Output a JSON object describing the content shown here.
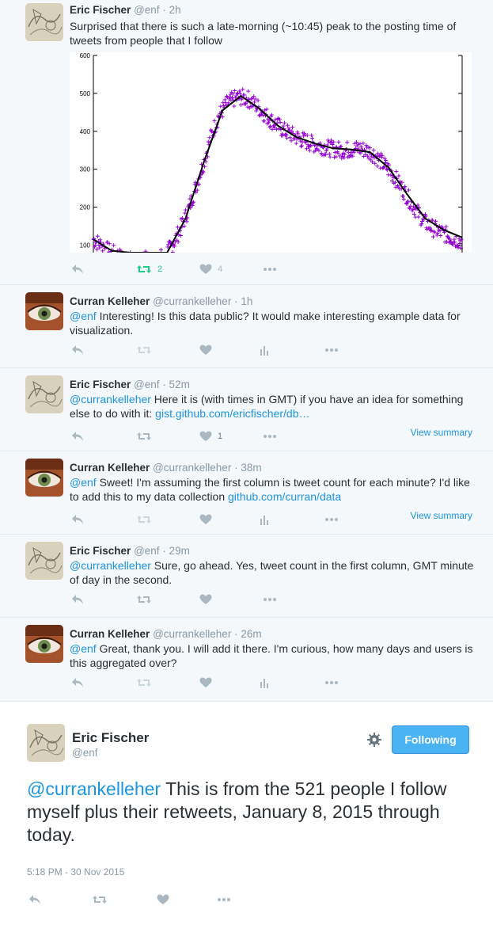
{
  "tweets": [
    {
      "name": "Eric Fischer",
      "handle": "@enf",
      "time": "· 2h",
      "avatar": "map",
      "text": "Surprised that there is such a late-morning (~10:45) peak to the posting time of tweets from people that I follow",
      "retweets": "2",
      "likes": "4",
      "retweet_active": true
    },
    {
      "name": "Curran Kelleher",
      "handle": "@currankelleher",
      "time": "· 1h",
      "avatar": "eye",
      "mention": "@enf",
      "text": " Interesting! Is this data public? It would make interesting example data for visualization."
    },
    {
      "name": "Eric Fischer",
      "handle": "@enf",
      "time": "· 52m",
      "avatar": "map",
      "mention": "@currankelleher",
      "text": " Here it is (with times in GMT) if you have an idea for something else to do with it: ",
      "link": "gist.github.com/ericfischer/db…",
      "likes": "1",
      "summary": "View summary"
    },
    {
      "name": "Curran Kelleher",
      "handle": "@currankelleher",
      "time": "· 38m",
      "avatar": "eye",
      "mention": "@enf",
      "text": " Sweet! I'm assuming the first column is tweet count for each minute? I'd like to add this to my data collection ",
      "link": "github.com/curran/data",
      "summary": "View summary"
    },
    {
      "name": "Eric Fischer",
      "handle": "@enf",
      "time": "· 29m",
      "avatar": "map",
      "mention": "@currankelleher",
      "text": " Sure, go ahead. Yes, tweet count in the first column, GMT minute of day in the second."
    },
    {
      "name": "Curran Kelleher",
      "handle": "@currankelleher",
      "time": "· 26m",
      "avatar": "eye",
      "mention": "@enf",
      "text": " Great, thank you. I will add it there. I'm curious, how many days and users is this aggregated over?"
    }
  ],
  "main_tweet": {
    "name": "Eric Fischer",
    "handle": "@enf",
    "mention": "@currankelleher",
    "text": " This is from the 521 people I follow myself plus their retweets, January 8, 2015 through today.",
    "timestamp": "5:18 PM - 30 Nov 2015",
    "follow_label": "Following"
  },
  "icons": {
    "reply": "reply-icon",
    "retweet": "retweet-icon",
    "like": "heart-icon",
    "more": "more-icon",
    "analytics": "analytics-icon",
    "settings": "gear-icon"
  },
  "colors": {
    "link": "#1b95e0",
    "retweet_active": "#19cf86",
    "follow_button": "#4ab3f4",
    "scatter": "#9400d3",
    "curve": "#000000"
  },
  "chart_data": {
    "type": "scatter",
    "ylim": [
      80,
      600
    ],
    "yticks": [
      100,
      200,
      300,
      400,
      500,
      600
    ],
    "xlim": [
      0,
      1
    ],
    "series": [
      {
        "style": "points",
        "x": [
          0.0,
          0.02,
          0.04,
          0.06,
          0.08,
          0.1,
          0.2,
          0.22,
          0.24,
          0.26,
          0.28,
          0.3,
          0.32,
          0.34,
          0.36,
          0.38,
          0.4,
          0.42,
          0.44,
          0.46,
          0.48,
          0.5,
          0.52,
          0.54,
          0.56,
          0.58,
          0.6,
          0.62,
          0.64,
          0.66,
          0.68,
          0.7,
          0.72,
          0.74,
          0.76,
          0.78,
          0.8,
          0.82,
          0.84,
          0.86,
          0.88,
          0.9,
          0.92,
          0.94,
          0.96,
          0.98,
          1.0
        ],
        "y": [
          115,
          100,
          85,
          75,
          65,
          60,
          80,
          110,
          150,
          200,
          260,
          320,
          390,
          440,
          470,
          485,
          490,
          485,
          470,
          450,
          430,
          415,
          400,
          390,
          380,
          372,
          365,
          360,
          355,
          352,
          350,
          352,
          355,
          350,
          340,
          320,
          300,
          275,
          245,
          215,
          185,
          160,
          145,
          135,
          125,
          115,
          110
        ]
      },
      {
        "style": "curve",
        "x": [
          0.0,
          0.05,
          0.1,
          0.15,
          0.2,
          0.25,
          0.3,
          0.35,
          0.4,
          0.45,
          0.5,
          0.55,
          0.6,
          0.65,
          0.7,
          0.75,
          0.8,
          0.85,
          0.9,
          0.95,
          1.0
        ],
        "y": [
          115,
          85,
          60,
          55,
          75,
          170,
          320,
          455,
          493,
          460,
          415,
          385,
          368,
          355,
          352,
          345,
          305,
          235,
          170,
          140,
          120
        ]
      }
    ]
  }
}
